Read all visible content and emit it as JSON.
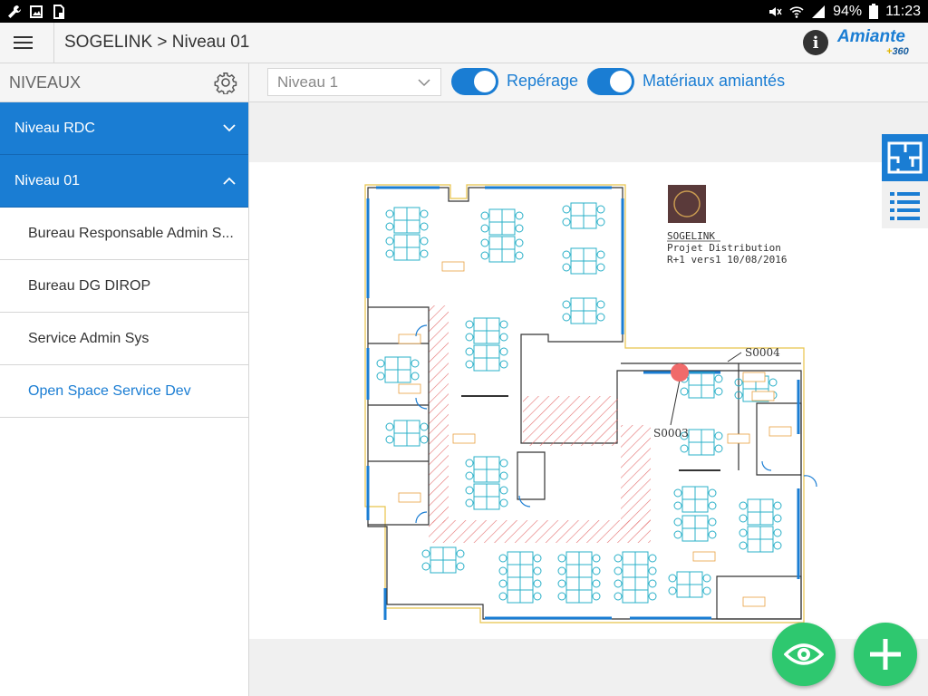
{
  "statusbar": {
    "battery": "94%",
    "time": "11:23"
  },
  "appbar": {
    "title": "SOGELINK > Niveau 01",
    "info_label": "i",
    "logo_main": "Amiante",
    "logo_sub": "360"
  },
  "sidebar": {
    "header": "NIVEAUX",
    "levels": [
      {
        "label": "Niveau RDC",
        "expanded": false
      },
      {
        "label": "Niveau 01",
        "expanded": true
      }
    ],
    "rooms": [
      {
        "label": "Bureau Responsable Admin S..."
      },
      {
        "label": "Bureau DG DIROP"
      },
      {
        "label": "Service Admin Sys"
      },
      {
        "label": "Open Space Service Dev",
        "active": true
      }
    ]
  },
  "toolbar": {
    "level_select": "Niveau 1",
    "toggle1_label": "Repérage",
    "toggle2_label": "Matériaux amiantés"
  },
  "plan": {
    "company": "SOGELINK",
    "project": "Projet Distribution",
    "version": "R+1 vers1 10/08/2016",
    "marker_a": "S0004",
    "marker_b": "S0003"
  },
  "colors": {
    "accent": "#1a7dd3",
    "fab": "#2ec86f",
    "marker": "#f06a6a"
  }
}
